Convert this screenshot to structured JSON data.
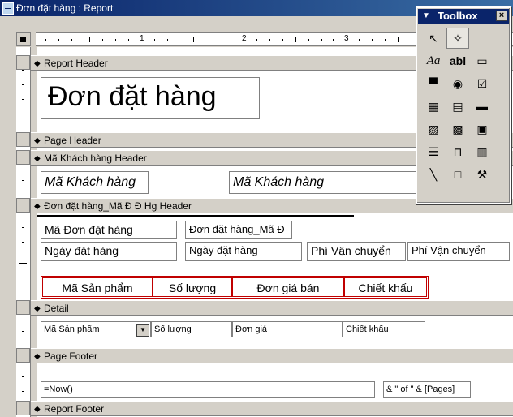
{
  "window": {
    "title": "Đơn đặt hàng : Report"
  },
  "ruler": {
    "numbers": [
      "1",
      "2",
      "3"
    ]
  },
  "sections": {
    "report_header": "Report Header",
    "page_header": "Page Header",
    "customer_header": "Mã Khách hàng Header",
    "order_header": "Đơn đặt hàng_Mã Đ Đ Hg Header",
    "detail": "Detail",
    "page_footer": "Page Footer",
    "report_footer": "Report Footer"
  },
  "report_header": {
    "title": "Đơn đặt hàng"
  },
  "customer_header": {
    "label": "Mã Khách hàng",
    "field": "Mã Khách hàng"
  },
  "order_header": {
    "order_id_label": "Mã Đơn đặt hàng",
    "order_id_field": "Đơn đặt hàng_Mã Đ",
    "order_date_label": "Ngày đặt hàng",
    "order_date_field": "Ngày đặt hàng",
    "shipping_label": "Phí Vận chuyển",
    "shipping_field": "Phí Vận chuyển",
    "columns": [
      "Mã Sản phẩm",
      "Số lượng",
      "Đơn giá bán",
      "Chiết khấu"
    ]
  },
  "detail": {
    "product": "Mã Sản phẩm",
    "quantity": "Số lượng",
    "price": "Đơn giá",
    "discount": "Chiết khấu"
  },
  "page_footer": {
    "now": "=Now()",
    "pages": "& \" of \" & [Pages]"
  },
  "toolbox": {
    "title": "Toolbox",
    "tools": [
      "select-objects-icon",
      "control-wizards-icon",
      "label-icon",
      "text-box-icon",
      "option-group-icon",
      "toggle-button-icon",
      "option-button-icon",
      "check-box-icon",
      "combo-box-icon",
      "list-box-icon",
      "command-button-icon",
      "image-icon",
      "unbound-object-frame-icon",
      "bound-object-frame-icon",
      "page-break-icon",
      "tab-control-icon",
      "subform-icon",
      "line-icon",
      "rectangle-icon",
      "more-controls-icon"
    ],
    "label_glyph": "Aa",
    "textbox_glyph": "abl"
  }
}
